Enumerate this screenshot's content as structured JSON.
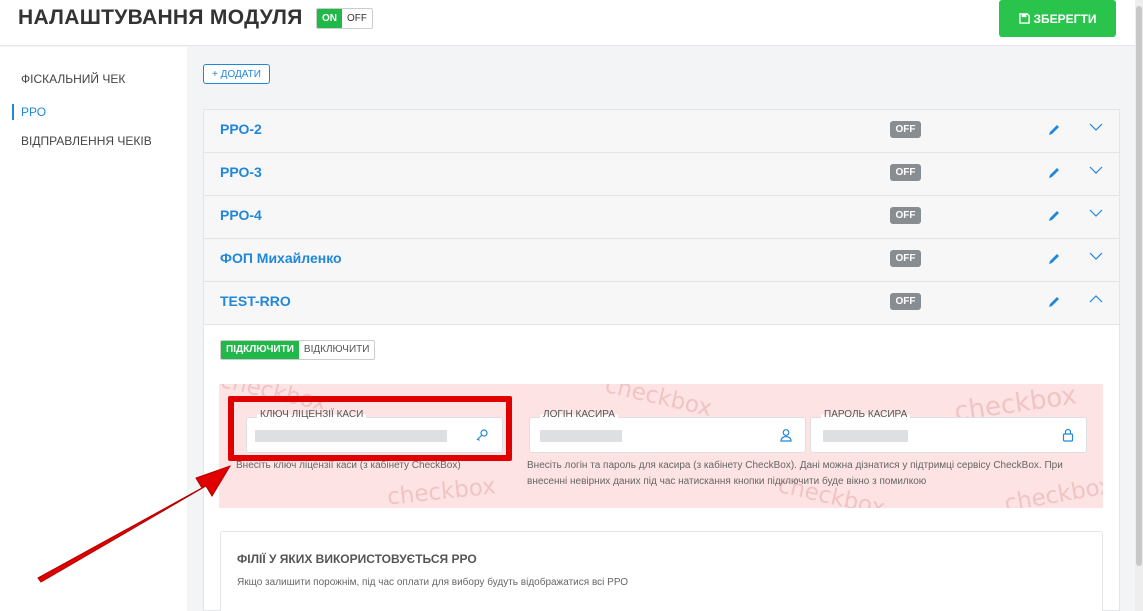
{
  "header": {
    "title": "НАЛАШТУВАННЯ МОДУЛЯ",
    "toggle_on": "ON",
    "toggle_off": "OFF",
    "save_label": "ЗБЕРЕГТИ"
  },
  "sidebar": {
    "items": [
      {
        "label": "ФІСКАЛЬНИЙ ЧЕК"
      },
      {
        "label": "РРО"
      },
      {
        "label": "ВІДПРАВЛЕННЯ ЧЕКІВ"
      }
    ]
  },
  "add_label": "+ ДОДАТИ",
  "rro_list": [
    {
      "name": "РРО-2",
      "status": "OFF"
    },
    {
      "name": "РРО-3",
      "status": "OFF"
    },
    {
      "name": "РРО-4",
      "status": "OFF"
    },
    {
      "name": "ФОП Михайленко",
      "status": "OFF"
    },
    {
      "name": "TEST-RRO",
      "status": "OFF"
    }
  ],
  "connect": {
    "on_label": "ПІДКЛЮЧИТИ",
    "off_label": "ВІДКЛЮЧИТИ"
  },
  "watermark": "checkbox",
  "fields": {
    "license_key": {
      "label": "КЛЮЧ ЛІЦЕНЗІЇ КАСИ",
      "hint": "Внесіть ключ ліцензії каси (з кабінету CheckBox)"
    },
    "login": {
      "label": "ЛОГІН КАСИРА"
    },
    "password": {
      "label": "ПАРОЛЬ КАСИРА"
    },
    "credentials_hint": "Внесіть логін та пароль для касира (з кабінету CheckBox). Дані можна дізнатися у підтримці сервісу CheckBox. При внесенні невірних даних під час натискання кнопки підключити буде вікно з помилкою"
  },
  "branches": {
    "title": "ФІЛІЇ У ЯКИХ ВИКОРИСТОВУЄТЬСЯ РРО",
    "hint": "Якщо залишити порожнім, під час оплати для вибору будуть відображатися всі РРО"
  },
  "colors": {
    "accent": "#2187d8",
    "success": "#21b84a",
    "highlight": "#e00000",
    "badge": "#888d92",
    "field_panel": "#fde3e3"
  }
}
